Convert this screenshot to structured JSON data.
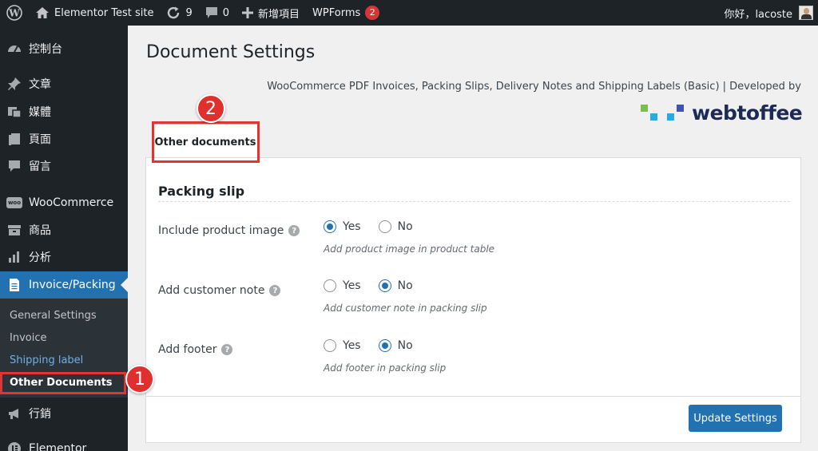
{
  "admin_bar": {
    "site_name": "Elementor Test site",
    "updates_count": "9",
    "comments_count": "0",
    "new_label": "新增項目",
    "wpforms_label": "WPForms",
    "wpforms_badge": "2",
    "greeting": "你好，lacoste"
  },
  "sidebar": {
    "items": [
      {
        "label": "控制台",
        "icon": "dashboard-icon"
      },
      {
        "label": "文章",
        "icon": "pin-icon"
      },
      {
        "label": "媒體",
        "icon": "media-icon"
      },
      {
        "label": "頁面",
        "icon": "page-icon"
      },
      {
        "label": "留言",
        "icon": "comment-icon"
      },
      {
        "label": "WooCommerce",
        "icon": "woocommerce-icon"
      },
      {
        "label": "商品",
        "icon": "archive-icon"
      },
      {
        "label": "分析",
        "icon": "bar-chart-icon"
      },
      {
        "label": "Invoice/Packing",
        "icon": "document-icon"
      },
      {
        "label": "行銷",
        "icon": "megaphone-icon"
      },
      {
        "label": "Elementor",
        "icon": "elementor-icon"
      }
    ],
    "submenu": [
      {
        "label": "General Settings"
      },
      {
        "label": "Invoice"
      },
      {
        "label": "Shipping label"
      },
      {
        "label": "Other Documents"
      }
    ]
  },
  "main": {
    "title": "Document Settings",
    "plugin_line": "WooCommerce PDF Invoices, Packing Slips, Delivery Notes and Shipping Labels (Basic) | Developed by",
    "logo_text": "webtoffee",
    "tab_label": "Other documents",
    "section_title": "Packing slip",
    "yes_label": "Yes",
    "no_label": "No",
    "rows": [
      {
        "label": "Include product image",
        "selected": "Yes",
        "description": "Add product image in product table"
      },
      {
        "label": "Add customer note",
        "selected": "No",
        "description": "Add customer note in packing slip"
      },
      {
        "label": "Add footer",
        "selected": "No",
        "description": "Add footer in packing slip"
      }
    ],
    "update_button": "Update Settings"
  },
  "annotations": {
    "badge_1": "1",
    "badge_2": "2",
    "callout_color": "#e03535"
  },
  "colors": {
    "admin_dark": "#1d2327",
    "accent_blue": "#2271b1",
    "badge_red": "#d63638"
  }
}
